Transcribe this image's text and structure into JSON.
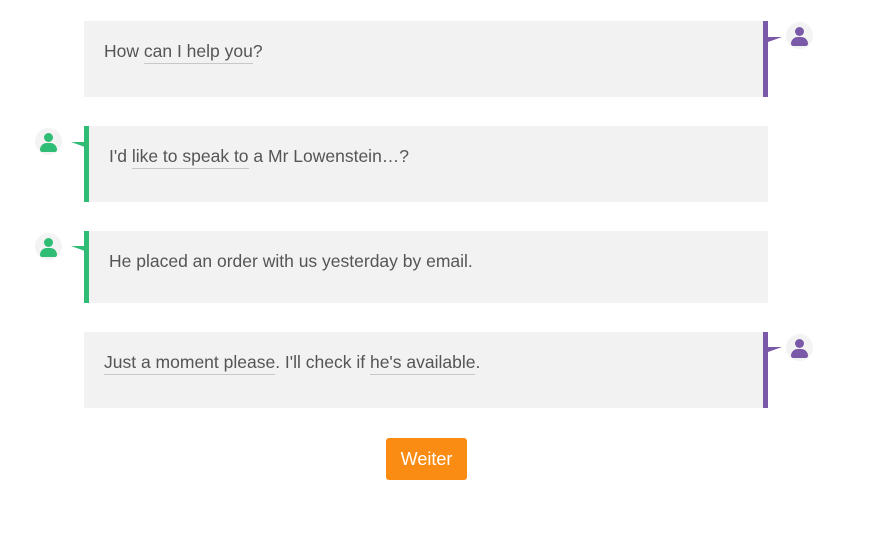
{
  "messages": [
    {
      "side": "right",
      "speaker_color": "#7a59a8",
      "segments": [
        {
          "text": "How ",
          "underline": false
        },
        {
          "text": "can I help you",
          "underline": true
        },
        {
          "text": "?",
          "underline": false
        }
      ]
    },
    {
      "side": "left",
      "speaker_color": "#2fbd75",
      "segments": [
        {
          "text": "I'd ",
          "underline": false
        },
        {
          "text": "like to speak to",
          "underline": true
        },
        {
          "text": " a Mr Lowenstein…?",
          "underline": false
        }
      ]
    },
    {
      "side": "left",
      "speaker_color": "#2fbd75",
      "segments": [
        {
          "text": "He placed an order with us yesterday by email.",
          "underline": false
        }
      ]
    },
    {
      "side": "right",
      "speaker_color": "#7a59a8",
      "segments": [
        {
          "text": "Just a moment please",
          "underline": true
        },
        {
          "text": ". I'll check if ",
          "underline": false
        },
        {
          "text": "he's available",
          "underline": true
        },
        {
          "text": ".",
          "underline": false
        }
      ]
    }
  ],
  "continue_button": {
    "label": "Weiter",
    "color": "#fb8c13"
  },
  "icons": {
    "speaker_avatar": "user-icon"
  }
}
